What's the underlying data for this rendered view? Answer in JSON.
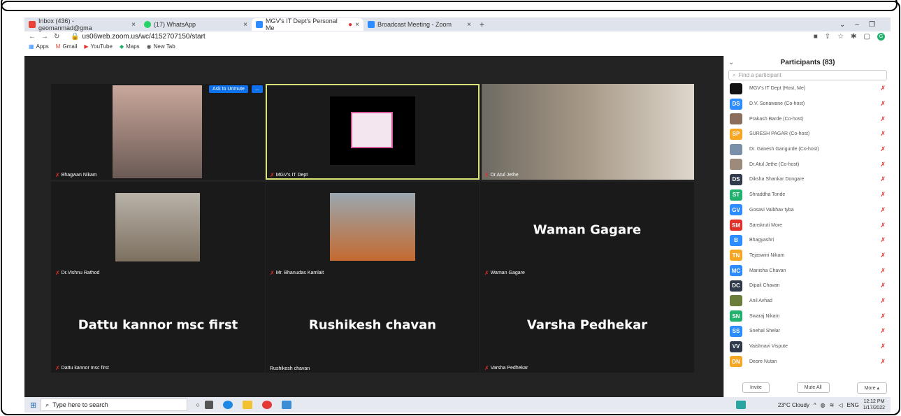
{
  "browser": {
    "tabs": [
      {
        "label": "Inbox (436) - geomanmad@gma",
        "favicon": "gmail-icon",
        "color": "#ea4335"
      },
      {
        "label": "(17) WhatsApp",
        "favicon": "whatsapp-icon",
        "color": "#25d366"
      },
      {
        "label": "MGV's IT Dept's Personal Me",
        "favicon": "zoom-icon",
        "color": "#2d8cff"
      },
      {
        "label": "Broadcast Meeting - Zoom",
        "favicon": "zoom-icon",
        "color": "#2d8cff"
      }
    ],
    "url": "us06web.zoom.us/wc/4152707150/start",
    "bookmarks": [
      "Apps",
      "Gmail",
      "YouTube",
      "Maps",
      "New Tab"
    ]
  },
  "meeting": {
    "ask_to_unmute": "Ask to Unmute",
    "more": "...",
    "tiles": [
      {
        "name": "Bhagwan Nikam",
        "display": ""
      },
      {
        "name": "MGV's IT Dept",
        "display": ""
      },
      {
        "name": "Dr.Atul Jethe",
        "display": ""
      },
      {
        "name": "Dr.Vishnu Rathod",
        "display": ""
      },
      {
        "name": "Mr. Bhanudas Kamlait",
        "display": ""
      },
      {
        "name": "Waman Gagare",
        "display": "Waman Gagare"
      },
      {
        "name": "Dattu kannor msc first",
        "display": "Dattu kannor msc first"
      },
      {
        "name": "Rushikesh chavan",
        "display": "Rushikesh chavan"
      },
      {
        "name": "Varsha Pedhekar",
        "display": "Varsha Pedhekar"
      }
    ]
  },
  "participants": {
    "title": "Participants (83)",
    "search_placeholder": "Find a participant",
    "list": [
      {
        "initials": "",
        "name": "MGV's IT Dept (Host, Me)",
        "color": "#111111"
      },
      {
        "initials": "DS",
        "name": "D.V. Sonawane (Co-host)",
        "color": "#2d8cff"
      },
      {
        "initials": "",
        "name": "Prakash Barde (Co-host)",
        "color": "#8a6d5a"
      },
      {
        "initials": "SP",
        "name": "SURESH PAGAR (Co-host)",
        "color": "#f5a623"
      },
      {
        "initials": "",
        "name": "Dr. Ganesh Gangurde (Co-host)",
        "color": "#7a8fa8"
      },
      {
        "initials": "",
        "name": "Dr.Atul Jethe (Co-host)",
        "color": "#9c8a7a"
      },
      {
        "initials": "DS",
        "name": "Diksha Shankar Dongare",
        "color": "#2f3b4c"
      },
      {
        "initials": "ST",
        "name": "Shraddha Tonde",
        "color": "#23b26d"
      },
      {
        "initials": "GV",
        "name": "Gosavi Vaibhav tyba",
        "color": "#2d8cff"
      },
      {
        "initials": "SM",
        "name": "Sanskruti More",
        "color": "#e0312a"
      },
      {
        "initials": "B",
        "name": "Bhagyashri",
        "color": "#2d8cff"
      },
      {
        "initials": "TN",
        "name": "Tejaswini Nikam",
        "color": "#f5a623"
      },
      {
        "initials": "MC",
        "name": "Manisha Chavan",
        "color": "#2d8cff"
      },
      {
        "initials": "DC",
        "name": "Dipali Chavan",
        "color": "#2f3b4c"
      },
      {
        "initials": "",
        "name": "Anil Avhad",
        "color": "#6a7d3a"
      },
      {
        "initials": "SN",
        "name": "Swaraj Nikam",
        "color": "#23b26d"
      },
      {
        "initials": "SS",
        "name": "Snehal Shelar",
        "color": "#2d8cff"
      },
      {
        "initials": "VV",
        "name": "Vaishnavi Vispute",
        "color": "#2f3b4c"
      },
      {
        "initials": "DN",
        "name": "Deore Nutan",
        "color": "#f5a623"
      }
    ],
    "invite": "Invite",
    "mute_all": "Mute All",
    "more": "More ▴"
  },
  "taskbar": {
    "search_placeholder": "Type here to search",
    "weather": "23°C  Cloudy",
    "lang": "ENG",
    "time": "12:12 PM",
    "date": "1/17/2022"
  }
}
